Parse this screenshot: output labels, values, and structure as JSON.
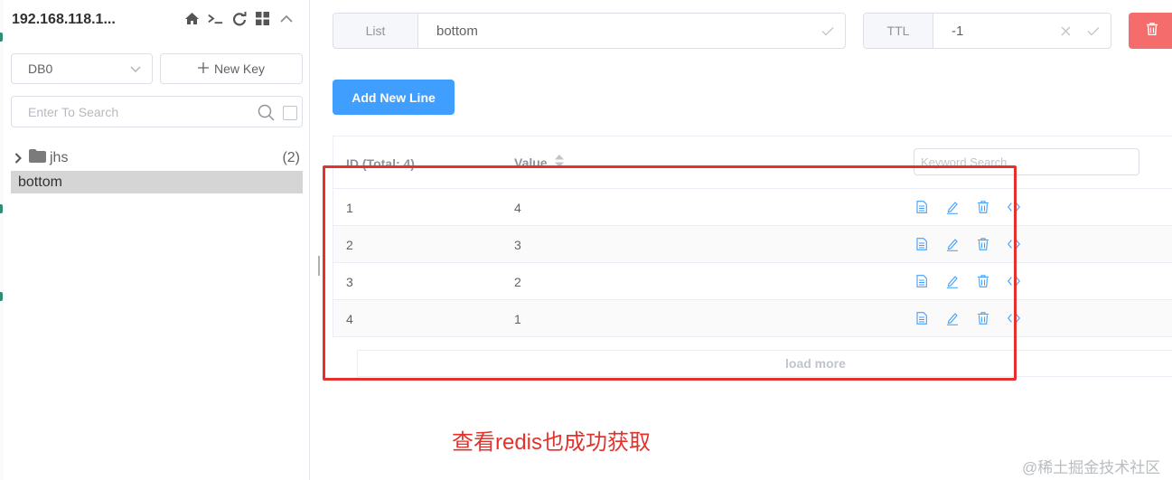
{
  "sidebar": {
    "connection_name": "192.168.118.1...",
    "icons": [
      "home-icon",
      "terminal-icon",
      "refresh-icon",
      "grid-icon",
      "chevron-up-icon"
    ],
    "db_select": "DB0",
    "new_key_label": "New Key",
    "search_placeholder": "Enter To Search",
    "tree": {
      "folder_name": "jhs",
      "folder_count": "(2)",
      "selected_key": "bottom"
    }
  },
  "key_header": {
    "type_label": "List",
    "key_name": "bottom",
    "ttl_label": "TTL",
    "ttl_value": "-1"
  },
  "actions": {
    "add_new_line": "Add New Line"
  },
  "table": {
    "id_header": "ID (Total: 4)",
    "value_header": "Value",
    "keyword_placeholder": "Keyword Search",
    "rows": [
      {
        "id": "1",
        "value": "4"
      },
      {
        "id": "2",
        "value": "3"
      },
      {
        "id": "3",
        "value": "2"
      },
      {
        "id": "4",
        "value": "1"
      }
    ],
    "row_action_icons": [
      "view-icon",
      "edit-icon",
      "delete-icon",
      "code-icon"
    ],
    "load_more": "load more"
  },
  "annotation": "查看redis也成功获取",
  "watermark": "@稀土掘金技术社区",
  "colors": {
    "primary": "#409eff",
    "danger": "#f56c6c",
    "annotation_red": "#e5312b"
  }
}
